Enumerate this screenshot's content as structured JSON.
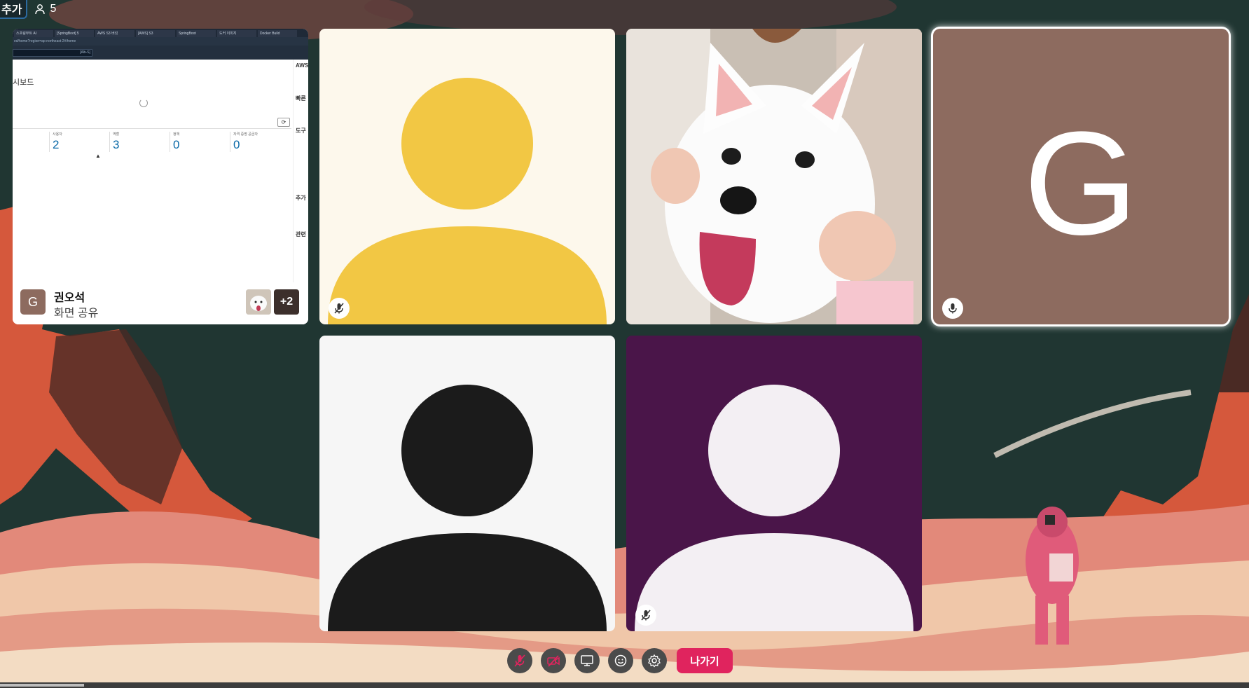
{
  "topbar": {
    "add_label": "추가",
    "participant_count": "5",
    "people_icon": "person-icon"
  },
  "screen_share": {
    "browser_tabs": [
      "스프링부트 AI",
      "[SpringBoot] 5",
      "AWS S3 버킷",
      "[AWS] S3",
      "SpringBoot",
      "도커 이미지",
      "Docker Build"
    ],
    "address": "ed/home?region=ap-northeast-2#/home",
    "search_hint": "[Alt+S]",
    "dashboard_title": "시보드",
    "refresh_label": "⟳",
    "metrics": [
      {
        "label": "사용자",
        "value": "2"
      },
      {
        "label": "역할",
        "value": "3"
      },
      {
        "label": "정책",
        "value": "0"
      },
      {
        "label": "자격 증명 공급자",
        "value": "0"
      }
    ],
    "side_panel": {
      "heading": "AWS",
      "sections": [
        "빠른",
        "도구",
        "추가",
        "관련"
      ]
    },
    "owner_initial": "G",
    "owner_name": "권오석",
    "share_label": "화면 공유",
    "more_count": "+2"
  },
  "participants": {
    "user1_state": "mic-off",
    "g_initial": "G",
    "g_state": "mic-on",
    "user4_state": "mic-off"
  },
  "controls": {
    "leave_label": "나가기",
    "icons": [
      "mic-off-icon",
      "camera-off-icon",
      "screen-share-icon",
      "emoji-icon",
      "settings-icon"
    ]
  },
  "colors": {
    "avatar_yellow": "#f2c744",
    "avatar_black": "#1b1b1b",
    "avatar_purple_bg": "#4a1549",
    "g_tile_bg": "#8d6b5f",
    "leave_button": "#e0245e"
  }
}
